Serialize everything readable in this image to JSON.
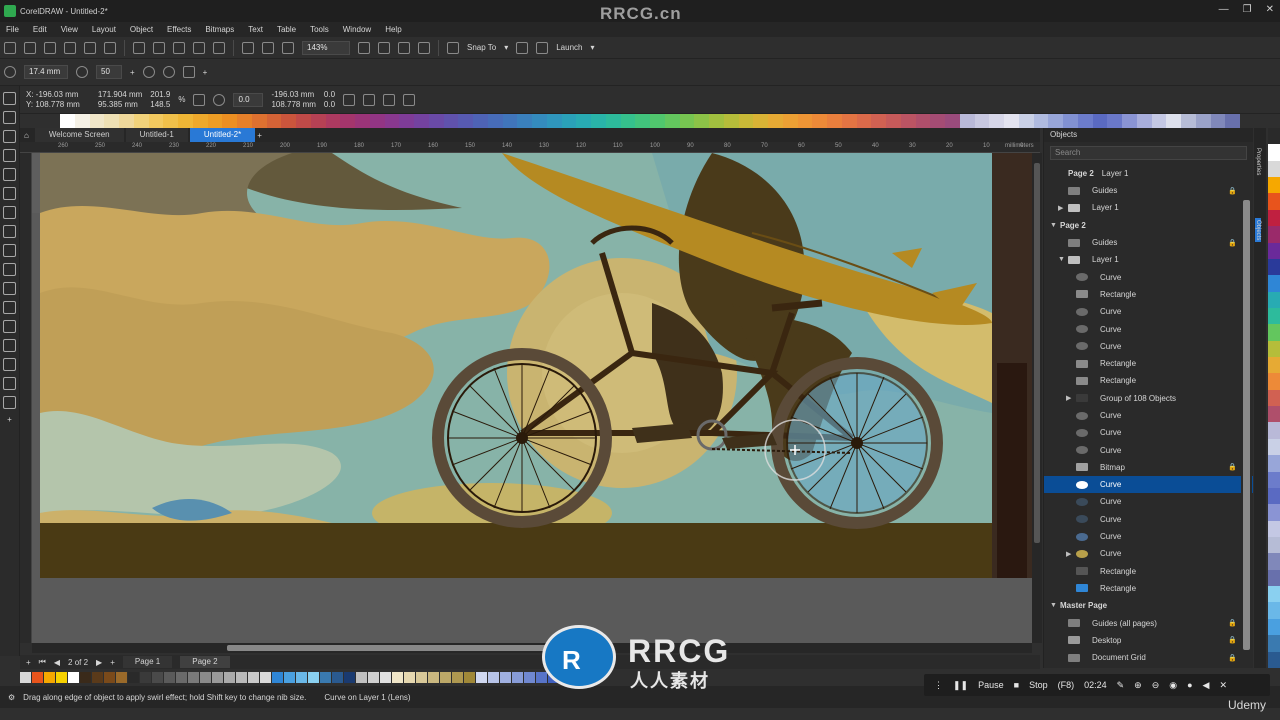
{
  "window": {
    "title": "CorelDRAW - Untitled-2*",
    "watermark": "RRCG.cn"
  },
  "menu": [
    "File",
    "Edit",
    "View",
    "Layout",
    "Object",
    "Effects",
    "Bitmaps",
    "Text",
    "Table",
    "Tools",
    "Window",
    "Help"
  ],
  "toolbar1": {
    "zoom": "143%",
    "snap_to": "Snap To",
    "launch": "Launch"
  },
  "toolbar2": {
    "nib_size": "17.4 mm",
    "speed": "50"
  },
  "toolbar3": {
    "x": "X: -196.03 mm",
    "y": "Y: 108.778 mm",
    "w": "171.904 mm",
    "h": "95.385 mm",
    "scale_x": "201.9",
    "scale_y": "148.5",
    "pct": "%",
    "rotation": "0.0",
    "pos_x": "-196.03 mm",
    "pos_y": "108.778 mm",
    "skew_x": "0.0",
    "skew_y": "0.0"
  },
  "doc_tabs": [
    {
      "label": "Welcome Screen",
      "active": false
    },
    {
      "label": "Untitled-1",
      "active": false
    },
    {
      "label": "Untitled-2*",
      "active": true
    }
  ],
  "ruler": {
    "ticks": [
      "260",
      "250",
      "240",
      "230",
      "220",
      "210",
      "200",
      "190",
      "180",
      "170",
      "160",
      "150",
      "140",
      "130",
      "120",
      "110",
      "100",
      "90",
      "80",
      "70",
      "60",
      "50",
      "40",
      "30",
      "20",
      "10",
      "0"
    ],
    "unit": "millimeters"
  },
  "page_nav": {
    "counter": "2 of 2",
    "pages": [
      "Page 1",
      "Page 2"
    ],
    "active_page": "Page 2"
  },
  "status": {
    "hint": "Drag along edge of object to apply swirl effect; hold Shift key to change nib size.",
    "object": "Curve on Layer 1 (Lens)"
  },
  "objects_docker": {
    "title": "Objects",
    "search_placeholder": "Search",
    "crumb_page": "Page 2",
    "crumb_layer": "Layer 1",
    "rows": [
      {
        "label": "Guides",
        "indent": 1,
        "tri": "",
        "icon": "guides-icon",
        "lock": true,
        "selected": false,
        "color": "#7f7f7f"
      },
      {
        "label": "Layer 1",
        "indent": 1,
        "tri": "▶",
        "icon": "layer-icon",
        "lock": false,
        "selected": false,
        "color": "#bfbfbf"
      },
      {
        "label": "Page 2",
        "indent": 0,
        "tri": "▼",
        "icon": "",
        "lock": false,
        "selected": false,
        "color": ""
      },
      {
        "label": "Guides",
        "indent": 1,
        "tri": "",
        "icon": "guides-icon",
        "lock": true,
        "selected": false,
        "color": "#7f7f7f"
      },
      {
        "label": "Layer 1",
        "indent": 1,
        "tri": "▼",
        "icon": "layer-icon",
        "lock": false,
        "selected": false,
        "color": "#bfbfbf"
      },
      {
        "label": "Curve",
        "indent": 2,
        "tri": "",
        "icon": "curve-icon",
        "lock": false,
        "selected": false,
        "color": "#6a6a6a"
      },
      {
        "label": "Rectangle",
        "indent": 2,
        "tri": "",
        "icon": "rectangle-icon",
        "lock": false,
        "selected": false,
        "color": "#8a8a8a"
      },
      {
        "label": "Curve",
        "indent": 2,
        "tri": "",
        "icon": "curve-icon",
        "lock": false,
        "selected": false,
        "color": "#6a6a6a"
      },
      {
        "label": "Curve",
        "indent": 2,
        "tri": "",
        "icon": "curve-icon",
        "lock": false,
        "selected": false,
        "color": "#6a6a6a"
      },
      {
        "label": "Curve",
        "indent": 2,
        "tri": "",
        "icon": "curve-icon",
        "lock": false,
        "selected": false,
        "color": "#6a6a6a"
      },
      {
        "label": "Rectangle",
        "indent": 2,
        "tri": "",
        "icon": "rectangle-icon",
        "lock": false,
        "selected": false,
        "color": "#8a8a8a"
      },
      {
        "label": "Rectangle",
        "indent": 2,
        "tri": "",
        "icon": "rectangle-icon",
        "lock": false,
        "selected": false,
        "color": "#8a8a8a"
      },
      {
        "label": "Group of 108 Objects",
        "indent": 2,
        "tri": "▶",
        "icon": "group-icon",
        "lock": false,
        "selected": false,
        "color": "#3a3a3a"
      },
      {
        "label": "Curve",
        "indent": 2,
        "tri": "",
        "icon": "curve-icon",
        "lock": false,
        "selected": false,
        "color": "#6a6a6a"
      },
      {
        "label": "Curve",
        "indent": 2,
        "tri": "",
        "icon": "curve-icon",
        "lock": false,
        "selected": false,
        "color": "#6a6a6a"
      },
      {
        "label": "Curve",
        "indent": 2,
        "tri": "",
        "icon": "curve-icon",
        "lock": false,
        "selected": false,
        "color": "#6a6a6a"
      },
      {
        "label": "Bitmap",
        "indent": 2,
        "tri": "",
        "icon": "bitmap-icon",
        "lock": true,
        "selected": false,
        "color": "#a0a0a0"
      },
      {
        "label": "Curve",
        "indent": 2,
        "tri": "",
        "icon": "curve-icon",
        "lock": false,
        "selected": true,
        "color": "#ffffff"
      },
      {
        "label": "Curve",
        "indent": 2,
        "tri": "",
        "icon": "curve-icon",
        "lock": false,
        "selected": false,
        "color": "#3a4a5a"
      },
      {
        "label": "Curve",
        "indent": 2,
        "tri": "",
        "icon": "curve-icon",
        "lock": false,
        "selected": false,
        "color": "#3a4a5a"
      },
      {
        "label": "Curve",
        "indent": 2,
        "tri": "",
        "icon": "curve-icon",
        "lock": false,
        "selected": false,
        "color": "#4a6a90"
      },
      {
        "label": "Curve",
        "indent": 2,
        "tri": "▶",
        "icon": "curve-icon",
        "lock": false,
        "selected": false,
        "color": "#b8a04a"
      },
      {
        "label": "Rectangle",
        "indent": 2,
        "tri": "",
        "icon": "rectangle-icon",
        "lock": false,
        "selected": false,
        "color": "#555555"
      },
      {
        "label": "Rectangle",
        "indent": 2,
        "tri": "",
        "icon": "rectangle-icon",
        "lock": false,
        "selected": false,
        "color": "#2f86d6"
      },
      {
        "label": "Master Page",
        "indent": 0,
        "tri": "▼",
        "icon": "",
        "lock": false,
        "selected": false,
        "color": ""
      },
      {
        "label": "Guides (all pages)",
        "indent": 1,
        "tri": "",
        "icon": "guides-icon",
        "lock": true,
        "selected": false,
        "color": "#7f7f7f"
      },
      {
        "label": "Desktop",
        "indent": 1,
        "tri": "",
        "icon": "desktop-icon",
        "lock": true,
        "selected": false,
        "color": "#9a9a9a"
      },
      {
        "label": "Document Grid",
        "indent": 1,
        "tri": "",
        "icon": "grid-icon",
        "lock": true,
        "selected": false,
        "color": "#7f7f7f"
      }
    ]
  },
  "side_tabs": [
    "Properties",
    "Objects"
  ],
  "player": {
    "pause": "Pause",
    "stop": "Stop",
    "stop_key": "(F8)",
    "time": "02:24"
  },
  "brand": {
    "udemy": "Udemy",
    "wm_big": "RRCG",
    "wm_small": "人人素材"
  },
  "colors": {
    "accent": "#2979d6",
    "selected_row": "#0a4d96"
  },
  "top_palette": [
    "#ffffff",
    "#f5f1e6",
    "#f0e6c8",
    "#eee0b4",
    "#efd89b",
    "#f1d27a",
    "#f2c95f",
    "#f0c04a",
    "#efb636",
    "#eea92c",
    "#ed9d25",
    "#ec8f22",
    "#e6802a",
    "#de7130",
    "#d46336",
    "#ca553c",
    "#c04a48",
    "#b64154",
    "#ad3a60",
    "#a4356c",
    "#9b3478",
    "#923584",
    "#89388f",
    "#7f3c98",
    "#7442a0",
    "#6a4aa7",
    "#6052ad",
    "#575ab2",
    "#4e63b6",
    "#476cb9",
    "#4075bb",
    "#3a80bd",
    "#348bbe",
    "#2f96bd",
    "#2aa1b9",
    "#28abb3",
    "#29b4a9",
    "#2dbb9c",
    "#35c18d",
    "#41c47d",
    "#50c66d",
    "#63c65e",
    "#77c551",
    "#8cc347",
    "#a1c03f",
    "#b5bd3a",
    "#c8b937",
    "#d9b335",
    "#e6aa34",
    "#eca034",
    "#ee9535",
    "#ed8a38",
    "#e97f3d",
    "#e37443",
    "#db6a4a",
    "#d16152",
    "#c65a5a",
    "#bb5463",
    "#af4f6b",
    "#a44c74",
    "#9a4b7c",
    "#b9b9d8",
    "#c8c8e0",
    "#d6d6e8",
    "#e3e3ef",
    "#c9d0e6",
    "#b0bbe0",
    "#98a6d9",
    "#8191d2",
    "#6c7ccb",
    "#5a6ac2",
    "#6a78c9",
    "#8a94d4",
    "#a8aedc",
    "#c4c8e4",
    "#dde0ec",
    "#b6bcd6",
    "#9aa2c8",
    "#8088ba",
    "#6870ac"
  ],
  "bottom_palette": [
    "#d9d9d9",
    "#e8541c",
    "#f6a800",
    "#f8d200",
    "#ffffff",
    "#3a2a1a",
    "#5a3a1a",
    "#7a4a1a",
    "#9a6a2a",
    "#2a2a2a",
    "#3a3a3a",
    "#4a4a4a",
    "#5a5a5a",
    "#6a6a6a",
    "#7a7a7a",
    "#8a8a8a",
    "#9a9a9a",
    "#aaaaaa",
    "#bababa",
    "#cacaca",
    "#dadada",
    "#2f86d6",
    "#4aa0e0",
    "#6ab8e8",
    "#8ad0f0",
    "#3a7ab0",
    "#2a5a90",
    "#1a3a70",
    "#c0c0c0",
    "#d0d0d0",
    "#e0e0e0",
    "#f0e6c8",
    "#e6d8b0",
    "#d8c898",
    "#cab880",
    "#bca868",
    "#ae9850",
    "#a08838",
    "#d0d8f0",
    "#b8c4e8",
    "#a0b0e0",
    "#889cd8",
    "#7088d0",
    "#5874c8",
    "#4060c0",
    "#e0e0e0",
    "#cfcfcf",
    "#bfbfbf"
  ],
  "right_palette": [
    "#2a2a2a",
    "#ffffff",
    "#d9d9d9",
    "#f6a800",
    "#e8541c",
    "#c02040",
    "#9a2a6a",
    "#6a2a9a",
    "#2a3a9a",
    "#2f86d6",
    "#28abb3",
    "#2dbb9c",
    "#63c65e",
    "#b5bd3a",
    "#e6aa34",
    "#ed8a38",
    "#d16152",
    "#af4f6b",
    "#b9b9d8",
    "#c9d0e6",
    "#98a6d9",
    "#6c7ccb",
    "#5a6ac2",
    "#8a94d4",
    "#c4c8e4",
    "#b6bcd6",
    "#8088ba",
    "#6870ac",
    "#8ad0f0",
    "#6ab8e8",
    "#4aa0e0",
    "#3a7ab0",
    "#2a5a90"
  ]
}
